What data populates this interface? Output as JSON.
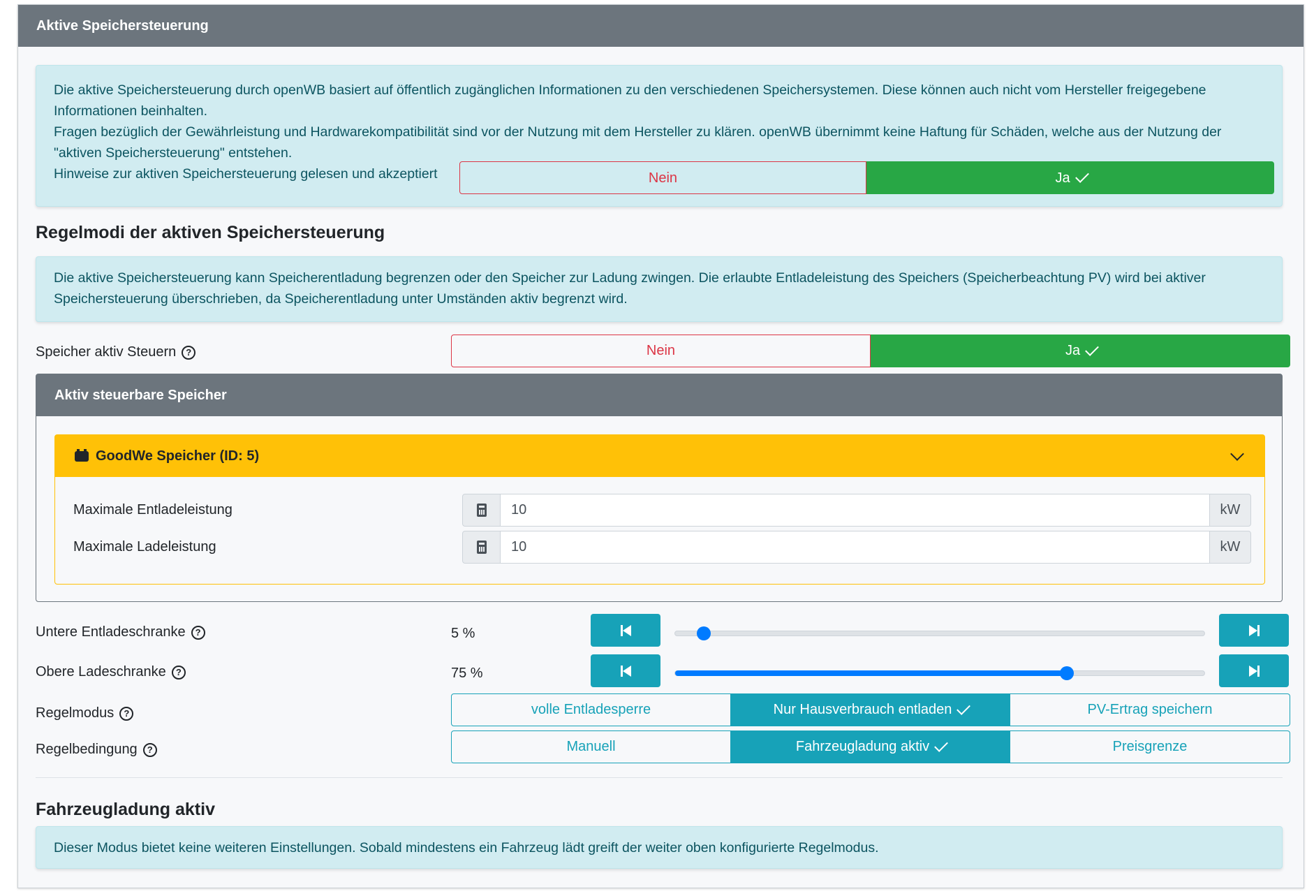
{
  "card": {
    "title": "Aktive Speichersteuerung"
  },
  "disclaimer": {
    "line1": "Die aktive Speichersteuerung durch openWB basiert auf öffentlich zugänglichen Informationen zu den verschiedenen Speichersystemen. Diese können auch nicht vom Hersteller freigegebene Informationen beinhalten.",
    "line2": "Fragen bezüglich der Gewährleistung und Hardwarekompatibilität sind vor der Nutzung mit dem Hersteller zu klären. openWB übernimmt keine Haftung für Schäden, welche aus der Nutzung der \"aktiven Speichersteuerung\" entstehen.",
    "accept_label": "Hinweise zur aktiven Speichersteuerung gelesen und akzeptiert",
    "no": "Nein",
    "yes": "Ja"
  },
  "regelmodi": {
    "heading": "Regelmodi der aktiven Speichersteuerung",
    "info": "Die aktive Speichersteuerung kann Speicherentladung begrenzen oder den Speicher zur Ladung zwingen. Die erlaubte Entladeleistung des Speichers (Speicherbeachtung PV) wird bei aktiver Speichersteuerung überschrieben, da Speicherentladung unter Umständen aktiv begrenzt wird."
  },
  "steuern": {
    "label": "Speicher aktiv Steuern",
    "no": "Nein",
    "yes": "Ja"
  },
  "speicher_card": {
    "title": "Aktiv steuerbare Speicher",
    "device": {
      "title": "GoodWe Speicher (ID: 5)",
      "fields": [
        {
          "label": "Maximale Entladeleistung",
          "value": "10",
          "unit": "kW"
        },
        {
          "label": "Maximale Ladeleistung",
          "value": "10",
          "unit": "kW"
        }
      ]
    }
  },
  "sliders": [
    {
      "label": "Untere Entladeschranke",
      "display": "5 %",
      "value": 5
    },
    {
      "label": "Obere Ladeschranke",
      "display": "75 %",
      "value": 75
    }
  ],
  "regelmodus": {
    "label": "Regelmodus",
    "options": [
      "volle Entladesperre",
      "Nur Hausverbrauch entladen",
      "PV-Ertrag speichern"
    ],
    "selected": 1
  },
  "regelbedingung": {
    "label": "Regelbedingung",
    "options": [
      "Manuell",
      "Fahrzeugladung aktiv",
      "Preisgrenze"
    ],
    "selected": 1
  },
  "fahrzeug": {
    "heading": "Fahrzeugladung aktiv",
    "info": "Dieser Modus bietet keine weiteren Einstellungen. Sobald mindestens ein Fahrzeug lädt greift der weiter oben konfigurierte Regelmodus."
  },
  "colors": {
    "success": "#28a745",
    "danger": "#dc3545",
    "info": "#17a2b8",
    "warning": "#ffc107",
    "primary": "#007bff"
  }
}
